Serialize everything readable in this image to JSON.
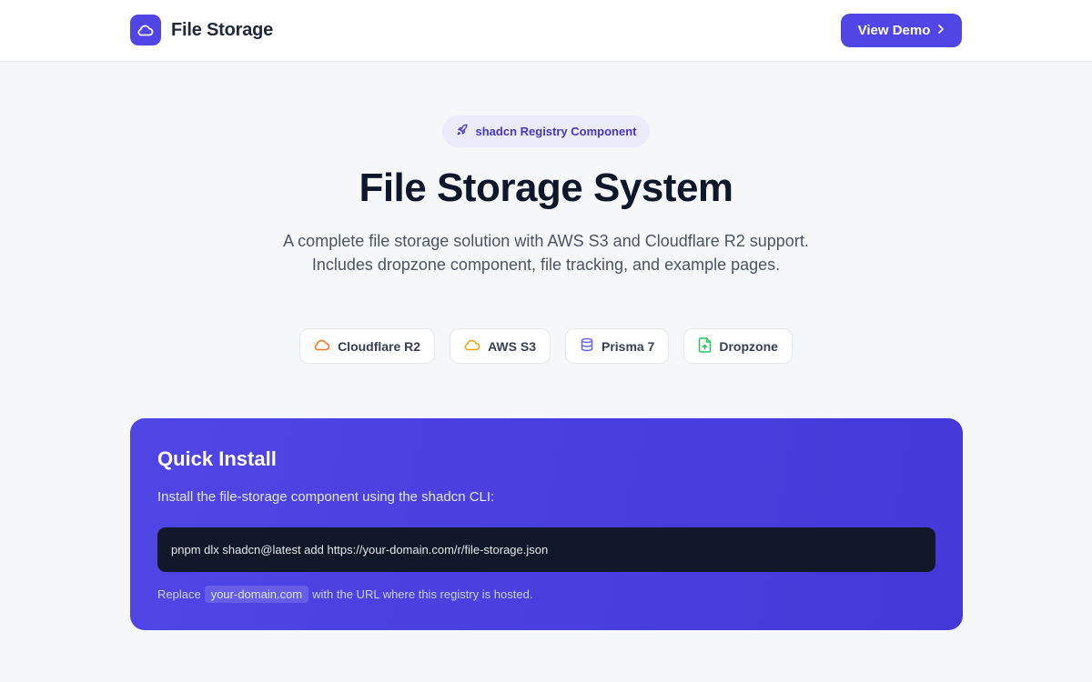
{
  "header": {
    "brand_name": "File Storage",
    "logo_icon": "cloud-icon",
    "demo_label": "View Demo",
    "demo_icon": "chevron-right-icon"
  },
  "hero": {
    "badge_label": "shadcn Registry Component",
    "badge_icon": "rocket-icon",
    "title": "File Storage System",
    "description": "A complete file storage solution with AWS S3 and Cloudflare R2 support. Includes dropzone component, file tracking, and example pages."
  },
  "features": [
    {
      "label": "Cloudflare R2",
      "icon": "cloud-icon",
      "color": "#f97316"
    },
    {
      "label": "AWS S3",
      "icon": "cloud-icon",
      "color": "#f59e0b"
    },
    {
      "label": "Prisma 7",
      "icon": "database-icon",
      "color": "#6366f1"
    },
    {
      "label": "Dropzone",
      "icon": "file-upload-icon",
      "color": "#22c55e"
    }
  ],
  "install": {
    "title": "Quick Install",
    "subtitle": "Install the file-storage component using the shadcn CLI:",
    "command": "pnpm dlx shadcn@latest add https://your-domain.com/r/file-storage.json",
    "note_prefix": "Replace",
    "note_code": "your-domain.com",
    "note_suffix": "with the URL where this registry is hosted."
  },
  "colors": {
    "accent": "#4f46e5",
    "background": "#f6f7f9",
    "code_background": "#111827"
  }
}
